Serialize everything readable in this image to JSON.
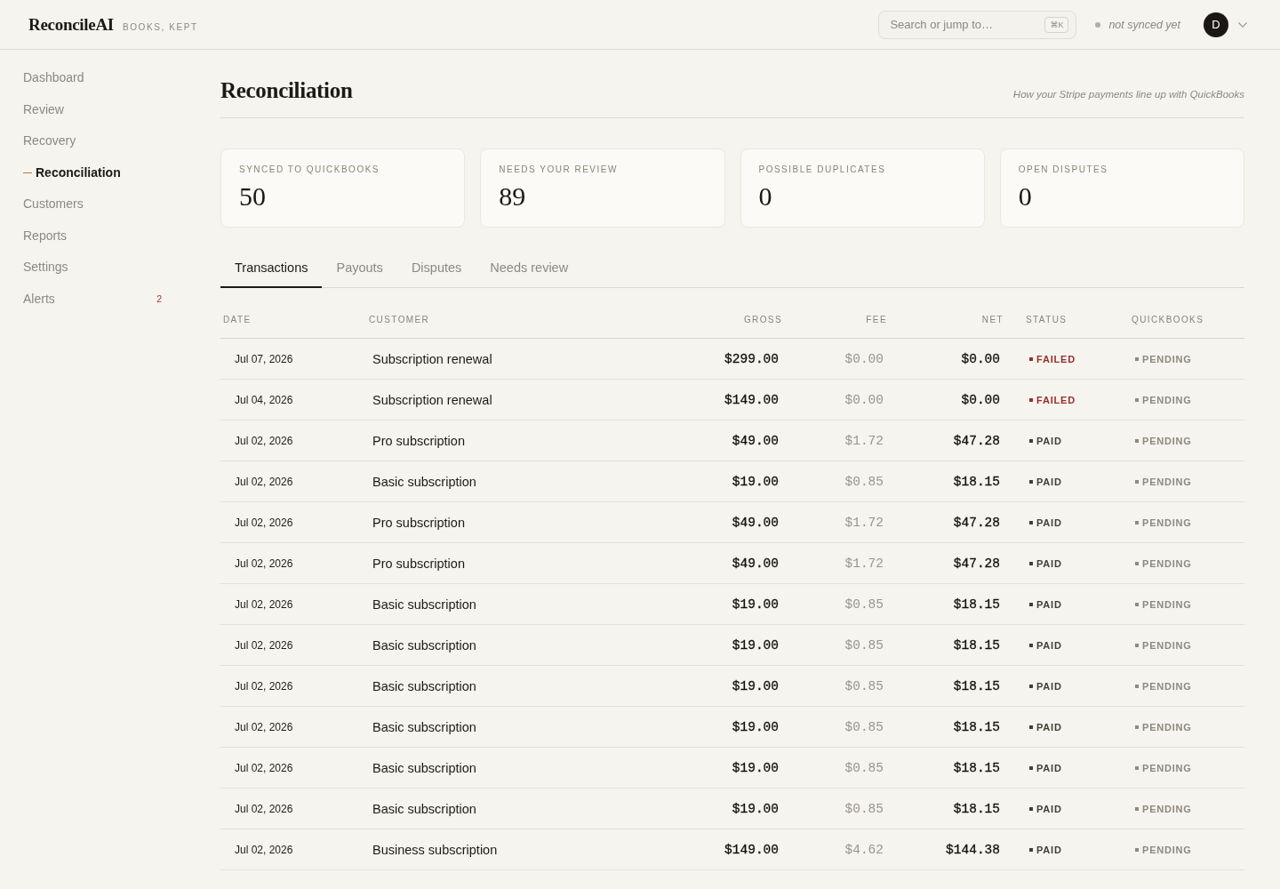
{
  "app": {
    "logo": "ReconcileAI",
    "tagline": "BOOKS, KEPT"
  },
  "topbar": {
    "search": {
      "placeholder": "Search or jump to…",
      "shortcut": "⌘K"
    },
    "sync_status": "not synced yet",
    "avatar": "D"
  },
  "sidebar": {
    "items": [
      {
        "label": "Dashboard",
        "selected": false
      },
      {
        "label": "Review",
        "selected": false
      },
      {
        "label": "Recovery",
        "selected": false
      },
      {
        "label": "Reconciliation",
        "selected": true
      },
      {
        "label": "Customers",
        "selected": false
      },
      {
        "label": "Reports",
        "selected": false
      },
      {
        "label": "Settings",
        "selected": false
      },
      {
        "label": "Alerts",
        "selected": false,
        "badge": "2"
      }
    ]
  },
  "page": {
    "title": "Reconciliation",
    "subtitle": "How your Stripe payments line up with QuickBooks"
  },
  "stats": [
    {
      "label": "SYNCED TO QUICKBOOKS",
      "value": "50"
    },
    {
      "label": "NEEDS YOUR REVIEW",
      "value": "89"
    },
    {
      "label": "POSSIBLE DUPLICATES",
      "value": "0"
    },
    {
      "label": "OPEN DISPUTES",
      "value": "0"
    }
  ],
  "tabs": [
    {
      "label": "Transactions",
      "selected": true
    },
    {
      "label": "Payouts",
      "selected": false
    },
    {
      "label": "Disputes",
      "selected": false
    },
    {
      "label": "Needs review",
      "selected": false
    }
  ],
  "table": {
    "columns": [
      "DATE",
      "CUSTOMER",
      "GROSS",
      "FEE",
      "NET",
      "STATUS",
      "QUICKBOOKS"
    ],
    "rows": [
      {
        "date": "Jul 07, 2026",
        "customer": "Subscription renewal",
        "gross": "$299.00",
        "fee": "$0.00",
        "net": "$0.00",
        "status": {
          "label": "FAILED",
          "color": "#9b2c2c"
        },
        "quickbooks": {
          "label": "PENDING",
          "color": "#8f897e"
        }
      },
      {
        "date": "Jul 04, 2026",
        "customer": "Subscription renewal",
        "gross": "$149.00",
        "fee": "$0.00",
        "net": "$0.00",
        "status": {
          "label": "FAILED",
          "color": "#9b2c2c"
        },
        "quickbooks": {
          "label": "PENDING",
          "color": "#8f897e"
        }
      },
      {
        "date": "Jul 02, 2026",
        "customer": "Pro subscription",
        "gross": "$49.00",
        "fee": "$1.72",
        "net": "$47.28",
        "status": {
          "label": "PAID",
          "color": "#3f4034"
        },
        "quickbooks": {
          "label": "PENDING",
          "color": "#8f897e"
        }
      },
      {
        "date": "Jul 02, 2026",
        "customer": "Basic subscription",
        "gross": "$19.00",
        "fee": "$0.85",
        "net": "$18.15",
        "status": {
          "label": "PAID",
          "color": "#3f4034"
        },
        "quickbooks": {
          "label": "PENDING",
          "color": "#8f897e"
        }
      },
      {
        "date": "Jul 02, 2026",
        "customer": "Pro subscription",
        "gross": "$49.00",
        "fee": "$1.72",
        "net": "$47.28",
        "status": {
          "label": "PAID",
          "color": "#3f4034"
        },
        "quickbooks": {
          "label": "PENDING",
          "color": "#8f897e"
        }
      },
      {
        "date": "Jul 02, 2026",
        "customer": "Pro subscription",
        "gross": "$49.00",
        "fee": "$1.72",
        "net": "$47.28",
        "status": {
          "label": "PAID",
          "color": "#3f4034"
        },
        "quickbooks": {
          "label": "PENDING",
          "color": "#8f897e"
        }
      },
      {
        "date": "Jul 02, 2026",
        "customer": "Basic subscription",
        "gross": "$19.00",
        "fee": "$0.85",
        "net": "$18.15",
        "status": {
          "label": "PAID",
          "color": "#3f4034"
        },
        "quickbooks": {
          "label": "PENDING",
          "color": "#8f897e"
        }
      },
      {
        "date": "Jul 02, 2026",
        "customer": "Basic subscription",
        "gross": "$19.00",
        "fee": "$0.85",
        "net": "$18.15",
        "status": {
          "label": "PAID",
          "color": "#3f4034"
        },
        "quickbooks": {
          "label": "PENDING",
          "color": "#8f897e"
        }
      },
      {
        "date": "Jul 02, 2026",
        "customer": "Basic subscription",
        "gross": "$19.00",
        "fee": "$0.85",
        "net": "$18.15",
        "status": {
          "label": "PAID",
          "color": "#3f4034"
        },
        "quickbooks": {
          "label": "PENDING",
          "color": "#8f897e"
        }
      },
      {
        "date": "Jul 02, 2026",
        "customer": "Basic subscription",
        "gross": "$19.00",
        "fee": "$0.85",
        "net": "$18.15",
        "status": {
          "label": "PAID",
          "color": "#3f4034"
        },
        "quickbooks": {
          "label": "PENDING",
          "color": "#8f897e"
        }
      },
      {
        "date": "Jul 02, 2026",
        "customer": "Basic subscription",
        "gross": "$19.00",
        "fee": "$0.85",
        "net": "$18.15",
        "status": {
          "label": "PAID",
          "color": "#3f4034"
        },
        "quickbooks": {
          "label": "PENDING",
          "color": "#8f897e"
        }
      },
      {
        "date": "Jul 02, 2026",
        "customer": "Basic subscription",
        "gross": "$19.00",
        "fee": "$0.85",
        "net": "$18.15",
        "status": {
          "label": "PAID",
          "color": "#3f4034"
        },
        "quickbooks": {
          "label": "PENDING",
          "color": "#8f897e"
        }
      },
      {
        "date": "Jul 02, 2026",
        "customer": "Business subscription",
        "gross": "$149.00",
        "fee": "$4.62",
        "net": "$144.38",
        "status": {
          "label": "PAID",
          "color": "#3f4034"
        },
        "quickbooks": {
          "label": "PENDING",
          "color": "#8f897e"
        }
      }
    ]
  }
}
